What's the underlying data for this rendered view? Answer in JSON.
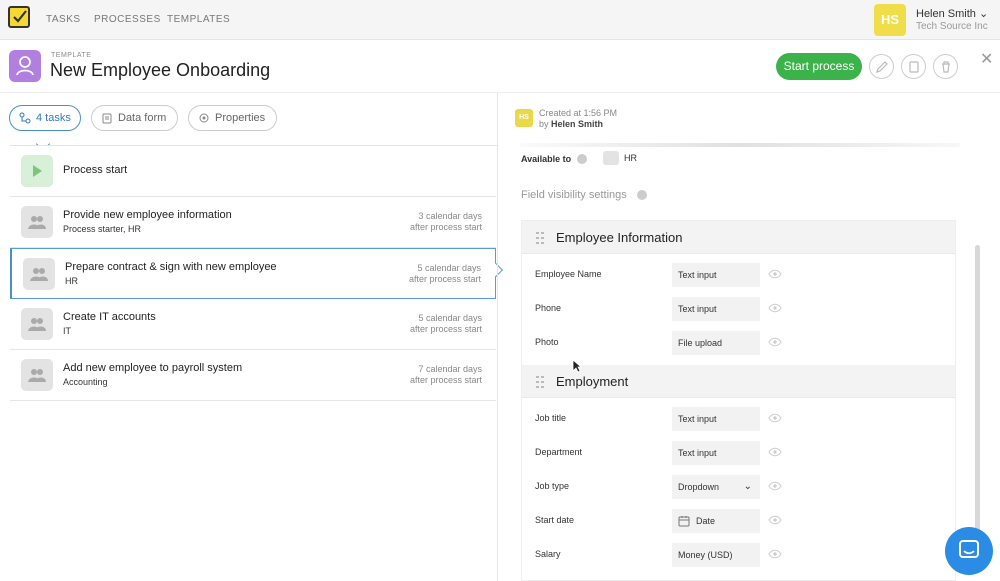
{
  "nav": {
    "items": [
      "TASKS",
      "PROCESSES",
      "TEMPLATES"
    ],
    "user_initials": "HS",
    "user_name": "Helen Smith",
    "user_org": "Tech Source Inc"
  },
  "header": {
    "label": "TEMPLATE",
    "title": "New Employee Onboarding",
    "start_label": "Start process",
    "close": "✕"
  },
  "tabs": [
    "4 tasks",
    "Data form",
    "Properties"
  ],
  "tasks": [
    {
      "name": "Process start",
      "sub": "",
      "d1": "",
      "d2": ""
    },
    {
      "name": "Provide new employee information",
      "sub": "Process starter, HR",
      "d1": "3 calendar days",
      "d2": "after process start"
    },
    {
      "name": "Prepare contract & sign with new employee",
      "sub": "HR",
      "d1": "5 calendar days",
      "d2": "after process start"
    },
    {
      "name": "Create IT accounts",
      "sub": "IT",
      "d1": "5 calendar days",
      "d2": "after process start"
    },
    {
      "name": "Add new employee to payroll system",
      "sub": "Accounting",
      "d1": "7 calendar days",
      "d2": "after process start"
    }
  ],
  "details": {
    "created_initials": "HS",
    "created_at": "Created at 1:56 PM",
    "created_by_prefix": "by",
    "created_by": "Helen Smith",
    "available_label": "Available to",
    "available_value": "HR",
    "field_visibility": "Field visibility settings"
  },
  "form": {
    "sections": [
      "Employee Information",
      "Employment"
    ],
    "fields": [
      {
        "label": "Employee Name",
        "type": "Text input"
      },
      {
        "label": "Phone",
        "type": "Text input"
      },
      {
        "label": "Photo",
        "type": "File upload"
      },
      {
        "label": "Job title",
        "type": "Text input"
      },
      {
        "label": "Department",
        "type": "Text input"
      },
      {
        "label": "Job type",
        "type": "Dropdown"
      },
      {
        "label": "Start date",
        "type": "Date"
      },
      {
        "label": "Salary",
        "type": "Money (USD)"
      }
    ]
  },
  "colors": {
    "accent_green": "#3bb34a",
    "accent_blue": "#2e7bbf",
    "logo_yellow": "#f5d833",
    "template_purple": "#b07fe0"
  }
}
